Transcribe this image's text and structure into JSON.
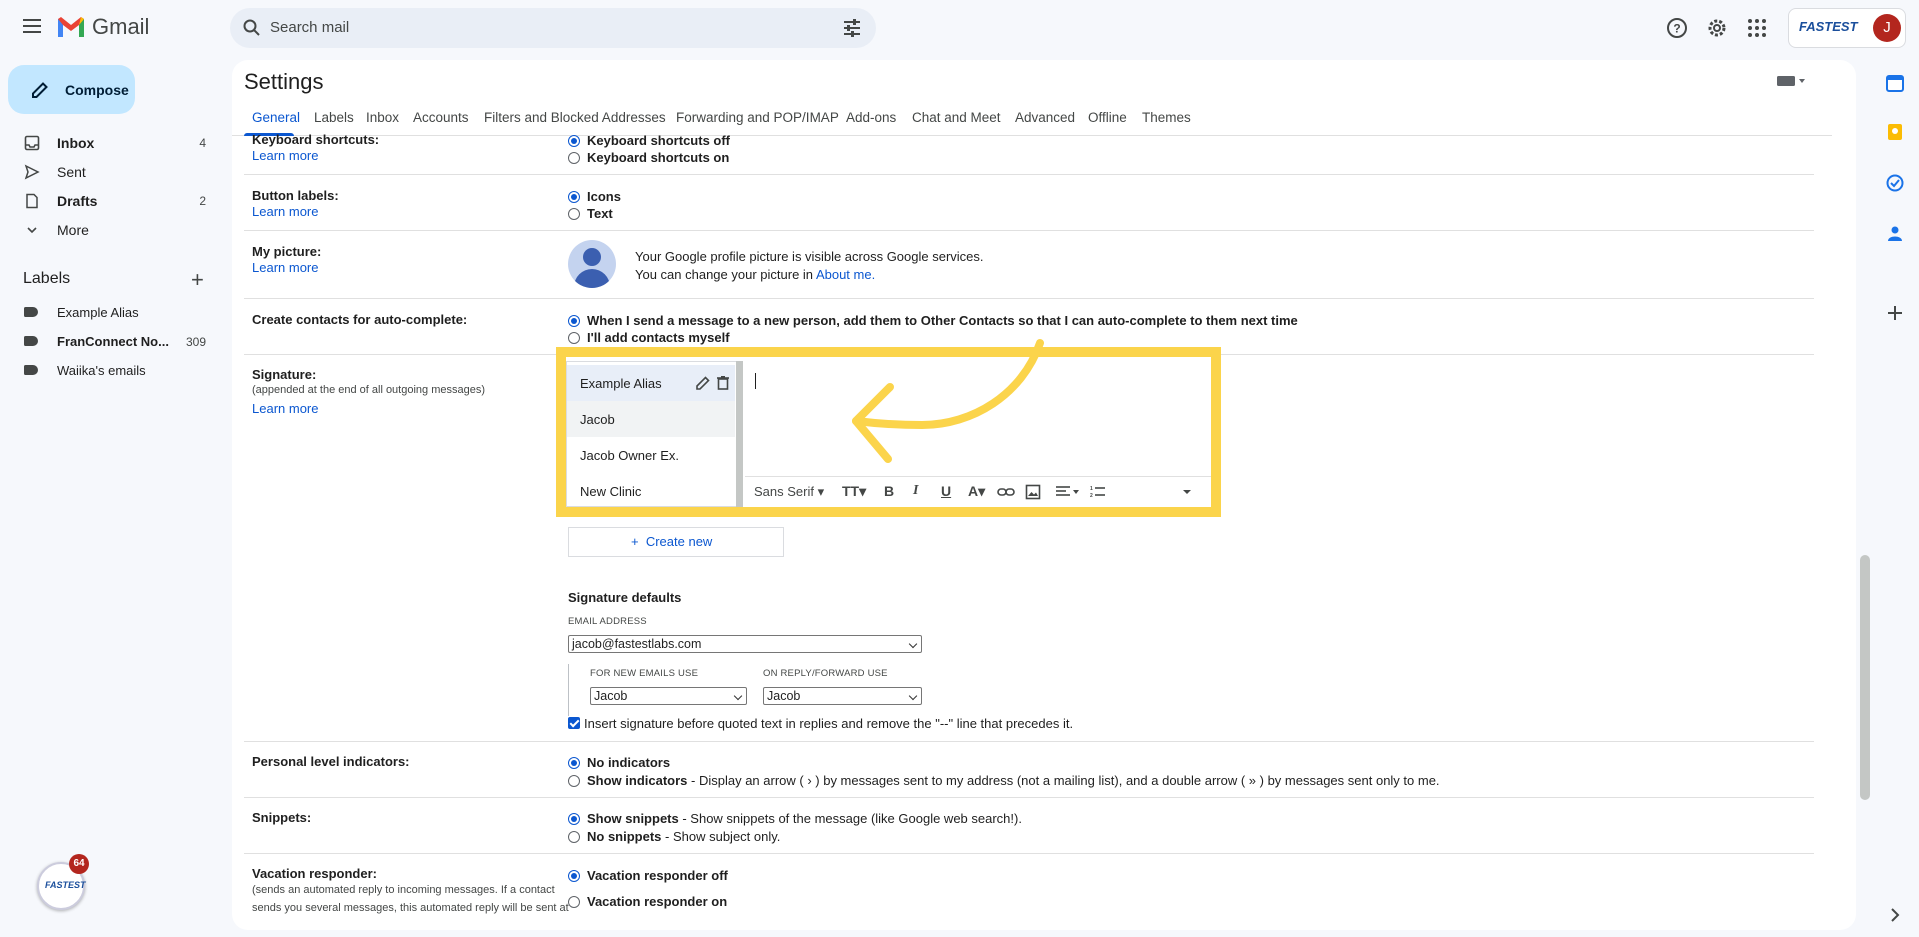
{
  "topbar": {
    "brand": "Gmail",
    "search_placeholder": "Search mail",
    "partner_logo": "FASTEST",
    "avatar_initial": "J"
  },
  "nav": {
    "compose": "Compose",
    "items": [
      {
        "label": "Inbox",
        "count": "4",
        "icon": "inbox-icon"
      },
      {
        "label": "Sent",
        "count": "",
        "icon": "send-icon"
      },
      {
        "label": "Drafts",
        "count": "2",
        "icon": "draft-icon"
      },
      {
        "label": "More",
        "count": "",
        "icon": "chevron-down-icon"
      }
    ],
    "labels_title": "Labels",
    "labels": [
      {
        "label": "Example Alias",
        "count": ""
      },
      {
        "label": "FranConnect No...",
        "count": "309"
      },
      {
        "label": "Waiika's emails",
        "count": ""
      }
    ],
    "extension_badge_count": "64",
    "extension_logo": "FASTEST"
  },
  "settings": {
    "title": "Settings",
    "tabs": [
      "General",
      "Labels",
      "Inbox",
      "Accounts",
      "Filters and Blocked Addresses",
      "Forwarding and POP/IMAP",
      "Add-ons",
      "Chat and Meet",
      "Advanced",
      "Offline",
      "Themes"
    ],
    "learn_more": "Learn more",
    "keyboard": {
      "label": "Keyboard shortcuts:",
      "off": "Keyboard shortcuts off",
      "on": "Keyboard shortcuts on"
    },
    "buttons": {
      "label": "Button labels:",
      "icons": "Icons",
      "text": "Text"
    },
    "picture": {
      "label": "My picture:",
      "line1": "Your Google profile picture is visible across Google services.",
      "line2_prefix": "You can change your picture in ",
      "line2_link": "About me."
    },
    "contacts": {
      "label": "Create contacts for auto-complete:",
      "opt1": "When I send a message to a new person, add them to Other Contacts so that I can auto-complete to them next time",
      "opt2": "I'll add contacts myself"
    },
    "signature": {
      "label": "Signature:",
      "sub": "(appended at the end of all outgoing messages)",
      "list": [
        "Example Alias",
        "Jacob",
        "Jacob Owner Ex.",
        "New Clinic"
      ],
      "font": "Sans Serif",
      "create_new": "Create new",
      "defaults_title": "Signature defaults",
      "email_address_caption": "EMAIL ADDRESS",
      "email_address": "jacob@fastestlabs.com",
      "new_emails_caption": "FOR NEW EMAILS USE",
      "new_emails_value": "Jacob",
      "reply_caption": "ON REPLY/FORWARD USE",
      "reply_value": "Jacob",
      "insert_before": "Insert signature before quoted text in replies and remove the \"--\" line that precedes it."
    },
    "indicators": {
      "label": "Personal level indicators:",
      "opt1": "No indicators",
      "opt2_bold": "Show indicators",
      "opt2_rest": " - Display an arrow ( › ) by messages sent to my address (not a mailing list), and a double arrow ( » ) by messages sent only to me."
    },
    "snippets": {
      "label": "Snippets:",
      "opt1_bold": "Show snippets",
      "opt1_rest": " - Show snippets of the message (like Google web search!).",
      "opt2_bold": "No snippets",
      "opt2_rest": " - Show subject only."
    },
    "vacation": {
      "label": "Vacation responder:",
      "sub1": "(sends an automated reply to incoming messages. If a contact",
      "sub2": "sends you several messages, this automated reply will be sent at",
      "opt1": "Vacation responder off",
      "opt2": "Vacation responder on"
    }
  },
  "colors": {
    "accent": "#0b57d0",
    "highlight": "#fbd44b",
    "compose_bg": "#c2e7ff"
  }
}
